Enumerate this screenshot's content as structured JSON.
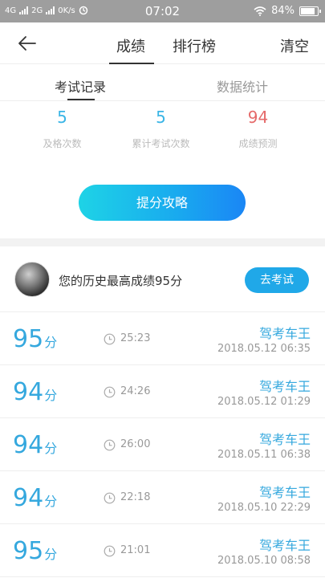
{
  "status_bar": {
    "net1": "4G",
    "net2": "2G",
    "speed": "0K/s",
    "time": "07:02",
    "battery": "84%"
  },
  "nav": {
    "tab_score": "成绩",
    "tab_rank": "排行榜",
    "clear": "清空"
  },
  "subtabs": {
    "records": "考试记录",
    "stats": "数据统计"
  },
  "stats": [
    {
      "value": "5",
      "label": "及格次数"
    },
    {
      "value": "5",
      "label": "累计考试次数"
    },
    {
      "value": "94",
      "label": "成绩预测"
    }
  ],
  "tip_button": "提分攻略",
  "best": {
    "text": "您的历史最高成绩95分",
    "go_button": "去考试"
  },
  "records": [
    {
      "score": "95",
      "unit": "分",
      "duration": "25:23",
      "title": "驾考车王",
      "date": "2018.05.12  06:35"
    },
    {
      "score": "94",
      "unit": "分",
      "duration": "24:26",
      "title": "驾考车王",
      "date": "2018.05.12  01:29"
    },
    {
      "score": "94",
      "unit": "分",
      "duration": "26:00",
      "title": "驾考车王",
      "date": "2018.05.11  06:38"
    },
    {
      "score": "94",
      "unit": "分",
      "duration": "22:18",
      "title": "驾考车王",
      "date": "2018.05.10  22:29"
    },
    {
      "score": "95",
      "unit": "分",
      "duration": "21:01",
      "title": "驾考车王",
      "date": "2018.05.10  08:58"
    }
  ],
  "colors": {
    "accent": "#35a8de",
    "predict": "#e56a6a",
    "button_start": "#1ed3e6",
    "button_end": "#1a86f5"
  }
}
